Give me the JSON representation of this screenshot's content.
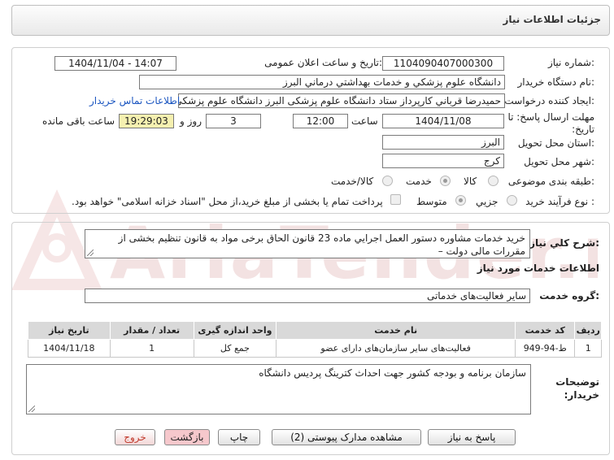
{
  "header": {
    "title": "جزئيات اطلاعات نياز"
  },
  "watermark": {
    "text": "AriaTender.net"
  },
  "info": {
    "need_number_label": "شماره نياز:",
    "need_number": "1104090407000300",
    "announce_label": "تاريخ و ساعت اعلان عمومی:",
    "announce_value": "1404/11/04 - 14:07",
    "buyer_label": "نام دستگاه خريدار:",
    "buyer_value": "دانشگاه علوم پزشکي و خدمات بهداشتي  درماني البرز",
    "creator_label": "ايجاد کننده درخواست:",
    "creator_value": "حميدرضا قرباني کارپرداز ستاد دانشگاه علوم پزشکی البرز دانشگاه علوم پزشکي",
    "contact_link": "اطلاعات تماس خريدار",
    "deadline_label": "مهلت ارسال پاسخ: تا تاريخ:",
    "deadline_date": "1404/11/08",
    "time_label": "ساعت",
    "deadline_time": "12:00",
    "days_value": "3",
    "days_label": "روز و",
    "remaining_value": "19:29:03",
    "remaining_label": "ساعت باقی مانده",
    "province_label": "استان محل تحويل:",
    "province_value": "البرز",
    "city_label": "شهر محل تحويل:",
    "city_value": "کرج",
    "category_label": "طبقه بندی موضوعی:",
    "category_options": [
      "کالا",
      "خدمت",
      "کالا/خدمت"
    ],
    "category_selected": "خدمت",
    "process_label": "نوع فرآيند خريد :",
    "process_options": [
      "جزيي",
      "متوسط"
    ],
    "process_selected": "متوسط",
    "payment_note": "پرداخت تمام يا بخشی از مبلغ خريد،از محل \"اسناد خزانه اسلامی\" خواهد بود."
  },
  "summary": {
    "label": "شرح کلي نياز:",
    "text": "خريد خدمات مشاوره دستور العمل اجرايي ماده 23 قانون الحاق برخی مواد به قانون تنظيم بخشی از مقررات مالی دولت –"
  },
  "services": {
    "section_title": "اطلاعات خدمات مورد نياز",
    "group_label": "گروه خدمت:",
    "group_value": "ساير فعاليت‌های خدماتی",
    "columns": [
      "رديف",
      "کد خدمت",
      "نام خدمت",
      "واحد اندازه گيری",
      "تعداد / مقدار",
      "تاريخ نياز"
    ],
    "rows": [
      [
        "1",
        "ط-94-949",
        "فعاليت‌های ساير سازمان‌های دارای عضو",
        "جمع کل",
        "1",
        "1404/11/18"
      ]
    ]
  },
  "buyer_notes": {
    "label": "توضيحات خريدار:",
    "text": "سازمان برنامه و بودجه کشور جهت احداث کترينگ پرديس دانشگاه"
  },
  "buttons": {
    "reply": "پاسخ به نياز",
    "docs": "مشاهده مدارک پيوستی (2)",
    "print": "چاپ",
    "back": "بازگشت",
    "exit": "خروج"
  },
  "colors": {
    "link": "#1a55c0",
    "remaining_bg": "#f5f0b0",
    "watermark": "#f1dcdc"
  }
}
